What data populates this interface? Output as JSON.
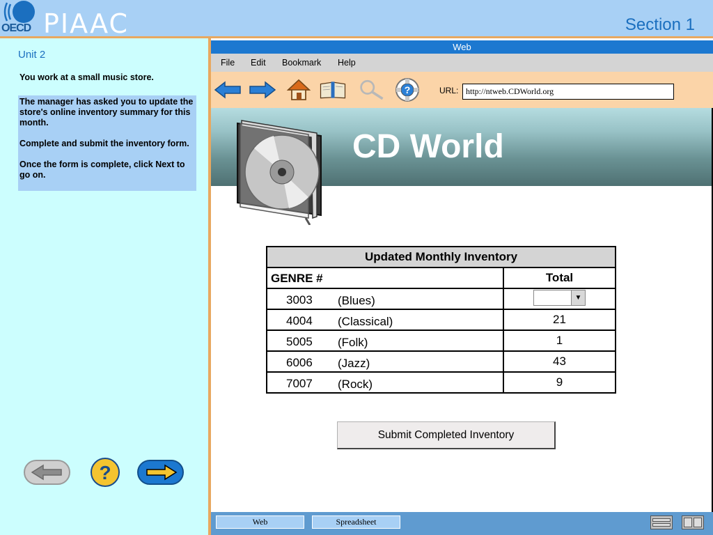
{
  "header": {
    "logo_text": "OECD",
    "brand": "PIAAC",
    "section": "Section 1"
  },
  "left_panel": {
    "unit": "Unit 2",
    "intro": "You work at a small music store.",
    "task_paragraphs": [
      "The manager has asked you to update the store's online inventory summary for this month.",
      "Complete and submit the inventory form.",
      "Once the form is complete, click Next to go on."
    ],
    "nav": {
      "back_icon": "arrow-left-icon",
      "help_icon": "question-mark-icon",
      "next_icon": "arrow-right-icon"
    }
  },
  "browser": {
    "title": "Web",
    "menu": [
      "File",
      "Edit",
      "Bookmark",
      "Help"
    ],
    "toolbar_icons": [
      "back-arrow-icon",
      "forward-arrow-icon",
      "home-icon",
      "bookmarks-book-icon",
      "search-magnifier-icon",
      "help-lifebuoy-icon"
    ],
    "url_label": "URL:",
    "url_value": "http://ntweb.CDWorld.org"
  },
  "page": {
    "site_title": "CD World",
    "table": {
      "caption": "Updated Monthly Inventory",
      "col_genre": "GENRE #",
      "col_total": "Total",
      "rows": [
        {
          "code": "3003",
          "name": "(Blues)",
          "total": ""
        },
        {
          "code": "4004",
          "name": "(Classical)",
          "total": "21"
        },
        {
          "code": "5005",
          "name": "(Folk)",
          "total": "1"
        },
        {
          "code": "6006",
          "name": "(Jazz)",
          "total": "43"
        },
        {
          "code": "7007",
          "name": "(Rock)",
          "total": "9"
        }
      ]
    },
    "submit_label": "Submit Completed Inventory"
  },
  "taskbar": {
    "tabs": [
      "Web",
      "Spreadsheet"
    ]
  },
  "colors": {
    "header_bg": "#a8d0f5",
    "accent_orange": "#e8a860",
    "panel_bg": "#ccfefe",
    "title_blue": "#1c78d0"
  }
}
